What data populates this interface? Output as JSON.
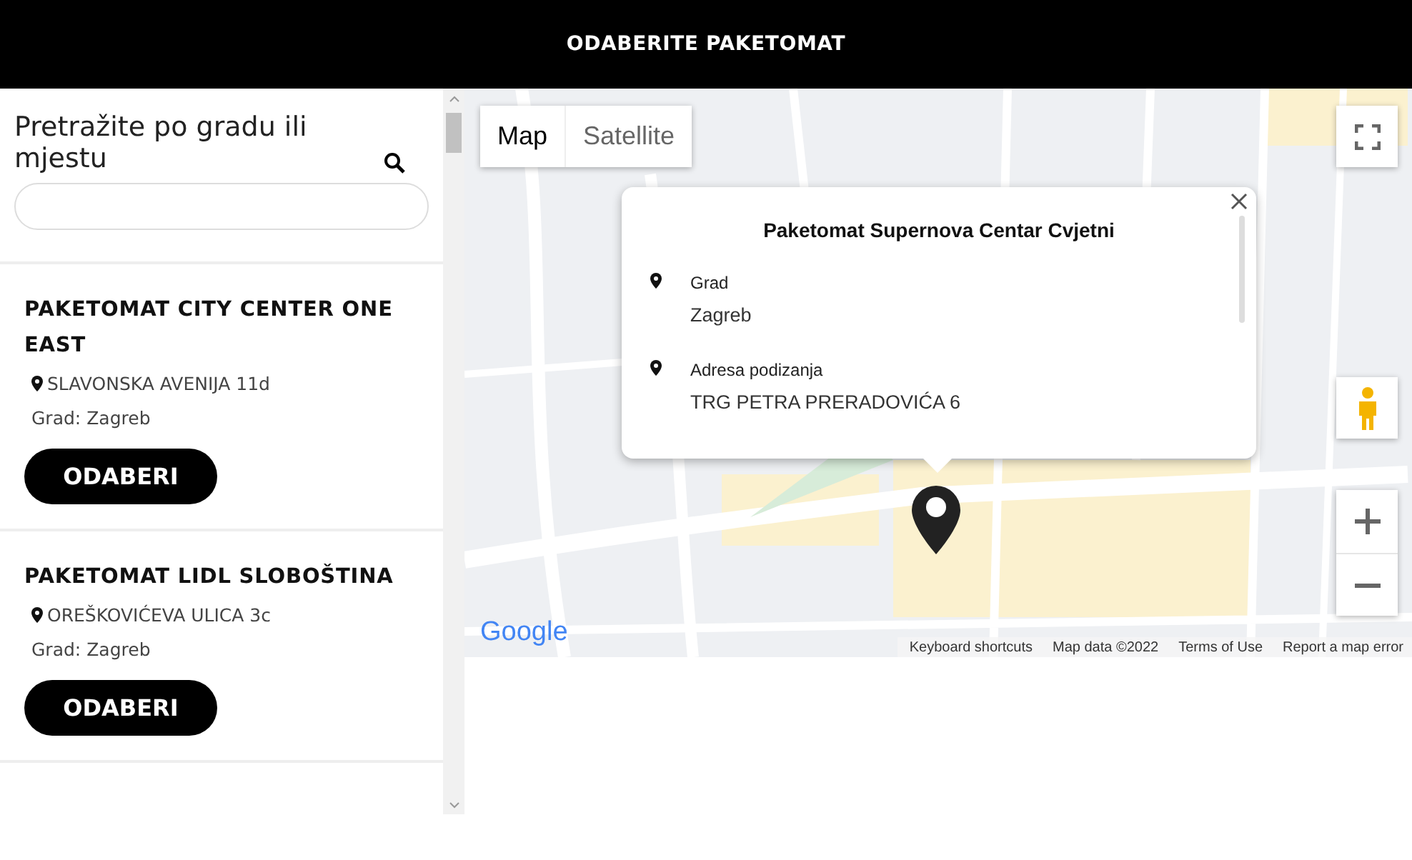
{
  "header": {
    "title": "ODABERITE PAKETOMAT"
  },
  "search": {
    "label": "Pretražite po gradu ili mjestu"
  },
  "locations": [
    {
      "name": "PAKETOMAT CITY CENTER ONE EAST",
      "address": "SLAVONSKA AVENIJA 11d",
      "city": "Grad: Zagreb",
      "button": "ODABERI"
    },
    {
      "name": "PAKETOMAT LIDL SLOBOŠTINA",
      "address": "OREŠKOVIĆEVA ULICA 3c",
      "city": "Grad: Zagreb",
      "button": "ODABERI"
    }
  ],
  "map": {
    "type_tabs": [
      {
        "label": "Map",
        "selected": true
      },
      {
        "label": "Satellite",
        "selected": false
      }
    ],
    "info_window": {
      "title": "Paketomat Supernova Centar Cvjetni",
      "fields": [
        {
          "label": "Grad",
          "value": "Zagreb"
        },
        {
          "label": "Adresa podizanja",
          "value": "TRG PETRA PRERADOVIĆA 6"
        }
      ]
    },
    "logo": "Google",
    "footer_links": [
      "Keyboard shortcuts",
      "Map data ©2022",
      "Terms of Use",
      "Report a map error"
    ]
  }
}
